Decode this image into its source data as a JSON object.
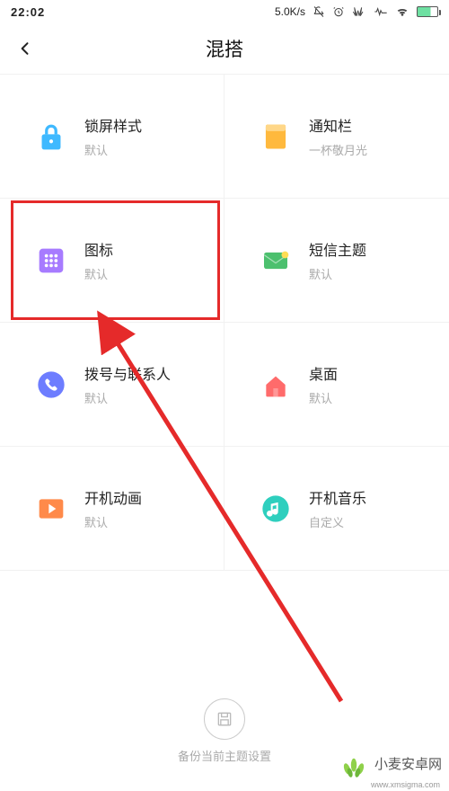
{
  "statusbar": {
    "time": "22:02",
    "netspeed": "5.0K/s"
  },
  "header": {
    "title": "混搭"
  },
  "grid": [
    {
      "key": "lockscreen",
      "label": "锁屏样式",
      "sub": "默认",
      "icon_color": "#3fb9ff"
    },
    {
      "key": "notification",
      "label": "通知栏",
      "sub": "一杯敬月光",
      "icon_color": "#ffb93d"
    },
    {
      "key": "icons",
      "label": "图标",
      "sub": "默认",
      "icon_color": "#a77bff",
      "highlighted": true
    },
    {
      "key": "sms",
      "label": "短信主题",
      "sub": "默认",
      "icon_color": "#4cc06e"
    },
    {
      "key": "dialer-contacts",
      "label": "拨号与联系人",
      "sub": "默认",
      "icon_color": "#6d7dff"
    },
    {
      "key": "desktop",
      "label": "桌面",
      "sub": "默认",
      "icon_color": "#ff6b6b"
    },
    {
      "key": "boot-animation",
      "label": "开机动画",
      "sub": "默认",
      "icon_color": "#ff8a4a"
    },
    {
      "key": "boot-sound",
      "label": "开机音乐",
      "sub": "自定义",
      "icon_color": "#2ecfbe"
    }
  ],
  "bottom_action": {
    "label": "备份当前主题设置"
  },
  "watermark": {
    "text": "小麦安卓网",
    "url": "www.xmsigma.com"
  }
}
